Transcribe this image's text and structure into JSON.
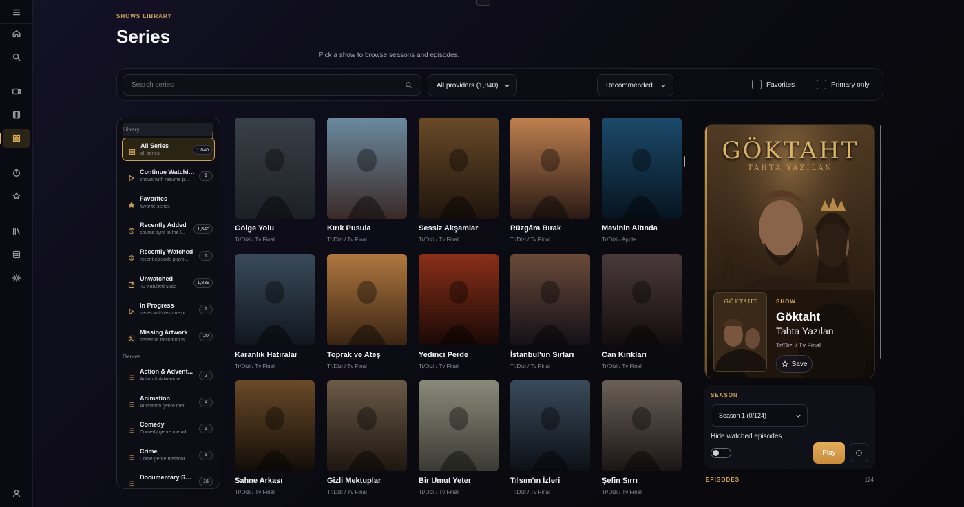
{
  "header": {
    "eyebrow": "SHOWS LIBRARY",
    "title": "Series",
    "subtitle": "Pick a show to browse seasons and episodes."
  },
  "toolbar": {
    "search_placeholder": "Search series",
    "provider": "All providers (1,840)",
    "sort": "Recommended",
    "favorites": "Favorites",
    "primary_only": "Primary only"
  },
  "library": {
    "section_library": "Library",
    "section_genres": "Genres",
    "items": [
      {
        "label": "All Series",
        "sub": "all series",
        "count": "1,840",
        "icon": "grid-icon"
      },
      {
        "label": "Continue Watching",
        "sub": "shows with resume p...",
        "count": "1",
        "icon": "play-icon"
      },
      {
        "label": "Favorites",
        "sub": "favorite series",
        "count": "",
        "icon": "star-icon"
      },
      {
        "label": "Recently Added",
        "sub": "source sync in the l...",
        "count": "1,840",
        "icon": "clock-icon"
      },
      {
        "label": "Recently Watched",
        "sub": "recent episode playb...",
        "count": "1",
        "icon": "history-icon"
      },
      {
        "label": "Unwatched",
        "sub": "no watched state",
        "count": "1,839",
        "icon": "external-icon"
      },
      {
        "label": "In Progress",
        "sub": "series with resume or...",
        "count": "1",
        "icon": "play-icon"
      },
      {
        "label": "Missing Artwork",
        "sub": "poster or backdrop is...",
        "count": "20",
        "icon": "image-icon"
      }
    ],
    "genres": [
      {
        "label": "Action & Advent...",
        "sub": "Action & Adventure...",
        "count": "2",
        "icon": "list-icon"
      },
      {
        "label": "Animation",
        "sub": "Animation genre met...",
        "count": "1",
        "icon": "list-icon"
      },
      {
        "label": "Comedy",
        "sub": "Comedy genre metad...",
        "count": "1",
        "icon": "list-icon"
      },
      {
        "label": "Crime",
        "sub": "Crime genre metadat...",
        "count": "5",
        "icon": "list-icon"
      },
      {
        "label": "Documentary Ser...",
        "sub": "",
        "count": "16",
        "icon": "list-icon"
      }
    ]
  },
  "shows": [
    {
      "name": "Gölge Yolu",
      "provider": "Tr/Dizi / Tv Final",
      "colors": [
        "#3a4048",
        "#1c2026"
      ]
    },
    {
      "name": "Kırık Pusula",
      "provider": "Tr/Dizi / Tv Final",
      "colors": [
        "#6b8aa0",
        "#3a2a28"
      ]
    },
    {
      "name": "Sessiz Akşamlar",
      "provider": "Tr/Dizi / Tv Final",
      "colors": [
        "#6a4a28",
        "#1e140c"
      ]
    },
    {
      "name": "Rüzgâra Bırak",
      "provider": "Tr/Dizi / Tv Final",
      "colors": [
        "#c08050",
        "#2a1a14"
      ]
    },
    {
      "name": "Mavinin Altında",
      "provider": "Tr/Dizi / Apple",
      "colors": [
        "#1c4a6a",
        "#061420"
      ]
    },
    {
      "name": "Karanlık Hatıralar",
      "provider": "Tr/Dizi / Tv Final",
      "colors": [
        "#3a4a5a",
        "#10161e"
      ]
    },
    {
      "name": "Toprak ve Ateş",
      "provider": "Tr/Dizi / Tv Final",
      "colors": [
        "#b07840",
        "#3a2414"
      ]
    },
    {
      "name": "Yedinci Perde",
      "provider": "Tr/Dizi / Tv Final",
      "colors": [
        "#8a3018",
        "#1a0806"
      ]
    },
    {
      "name": "İstanbul'un Sırları",
      "provider": "Tr/Dizi / Tv Final",
      "colors": [
        "#6a4a38",
        "#141018"
      ]
    },
    {
      "name": "Can Kırıkları",
      "provider": "Tr/Dizi / Tv Final",
      "colors": [
        "#4a3a3a",
        "#140c0e"
      ]
    },
    {
      "name": "Sahne Arkası",
      "provider": "Tr/Dizi / Tv Final",
      "colors": [
        "#6a4a28",
        "#120c08"
      ]
    },
    {
      "name": "Gizli Mektuplar",
      "provider": "Tr/Dizi / Tv Final",
      "colors": [
        "#6a5a48",
        "#1e1610"
      ]
    },
    {
      "name": "Bir Umut Yeter",
      "provider": "Tr/Dizi / Tv Final",
      "colors": [
        "#8a8a7a",
        "#3a3a34"
      ]
    },
    {
      "name": "Tılsım'ın İzleri",
      "provider": "Tr/Dizi / Tv Final",
      "colors": [
        "#3a4a5a",
        "#0c1016"
      ]
    },
    {
      "name": "Şefin Sırrı",
      "provider": "Tr/Dizi / Tv Final",
      "colors": [
        "#6a6058",
        "#1a1614"
      ]
    }
  ],
  "detail": {
    "logo_title": "GÖKTAHT",
    "logo_sub": "TAHTA YAZILAN",
    "poster_text": "GÖKTAHT",
    "kind": "SHOW",
    "title": "Göktaht",
    "subtitle": "Tahta Yazılan",
    "provider": "Tr/Dizi / Tv Final",
    "save": "Save",
    "colors": [
      "#6a4a2a",
      "#1a120c"
    ]
  },
  "season": {
    "label": "SEASON",
    "selected": "Season 1 (0/124)",
    "hide_watched": "Hide watched episodes",
    "play": "Play",
    "episodes_label": "EPISODES",
    "episodes_count": "124"
  },
  "theme": {
    "accent": "#c9a15a",
    "play": "#d89a48",
    "bg": "#0b0b12"
  }
}
